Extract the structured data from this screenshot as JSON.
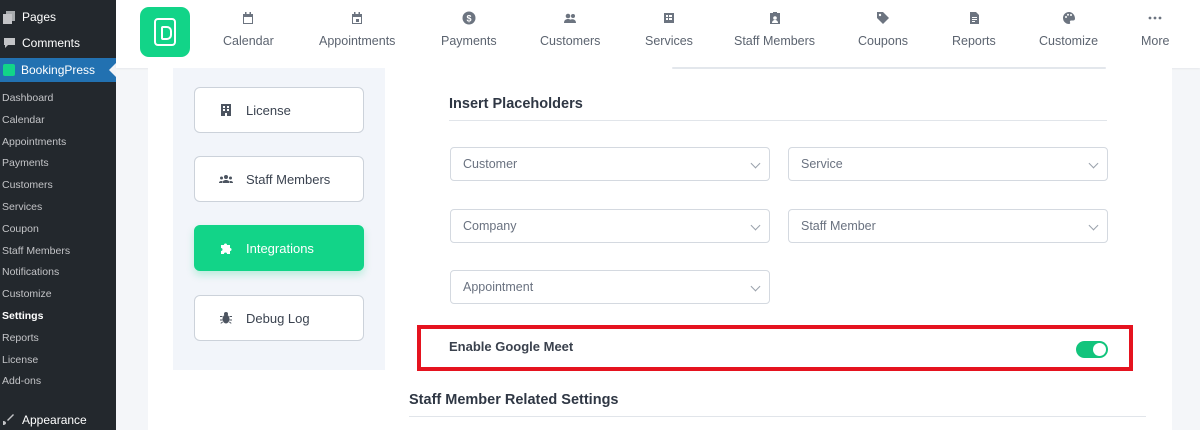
{
  "wp_sidebar": {
    "pages": "Pages",
    "comments": "Comments",
    "bookingpress": "BookingPress",
    "submenu": [
      {
        "label": "Dashboard"
      },
      {
        "label": "Calendar"
      },
      {
        "label": "Appointments"
      },
      {
        "label": "Payments"
      },
      {
        "label": "Customers"
      },
      {
        "label": "Services"
      },
      {
        "label": "Coupon"
      },
      {
        "label": "Staff Members"
      },
      {
        "label": "Notifications"
      },
      {
        "label": "Customize"
      },
      {
        "label": "Settings",
        "current": true
      },
      {
        "label": "Reports"
      },
      {
        "label": "License"
      },
      {
        "label": "Add-ons"
      }
    ],
    "appearance": "Appearance"
  },
  "topnav": {
    "items": [
      {
        "label": "Calendar",
        "icon": "calendar-icon"
      },
      {
        "label": "Appointments",
        "icon": "appointments-icon"
      },
      {
        "label": "Payments",
        "icon": "dollar-icon"
      },
      {
        "label": "Customers",
        "icon": "customers-icon"
      },
      {
        "label": "Services",
        "icon": "services-icon"
      },
      {
        "label": "Staff Members",
        "icon": "staff-badge-icon"
      },
      {
        "label": "Coupons",
        "icon": "tag-icon"
      },
      {
        "label": "Reports",
        "icon": "report-icon"
      },
      {
        "label": "Customize",
        "icon": "palette-icon"
      },
      {
        "label": "More",
        "icon": "more-dots-icon"
      }
    ]
  },
  "settings_menu": {
    "items": [
      {
        "label": "License",
        "icon": "building-icon"
      },
      {
        "label": "Staff Members",
        "icon": "users-icon"
      },
      {
        "label": "Integrations",
        "icon": "puzzle-icon",
        "active": true
      },
      {
        "label": "Debug Log",
        "icon": "bug-icon"
      }
    ]
  },
  "placeholders": {
    "title": "Insert Placeholders",
    "selects": [
      {
        "value": "Customer"
      },
      {
        "value": "Service"
      },
      {
        "value": "Company"
      },
      {
        "value": "Staff Member"
      },
      {
        "value": "Appointment"
      }
    ]
  },
  "google_meet": {
    "label": "Enable Google Meet",
    "enabled": true
  },
  "staff_section": {
    "title": "Staff Member Related Settings"
  },
  "colors": {
    "accent": "#12d488",
    "wp_sidebar": "#23282d",
    "wp_active": "#2271b1",
    "highlight": "#e5131f"
  }
}
